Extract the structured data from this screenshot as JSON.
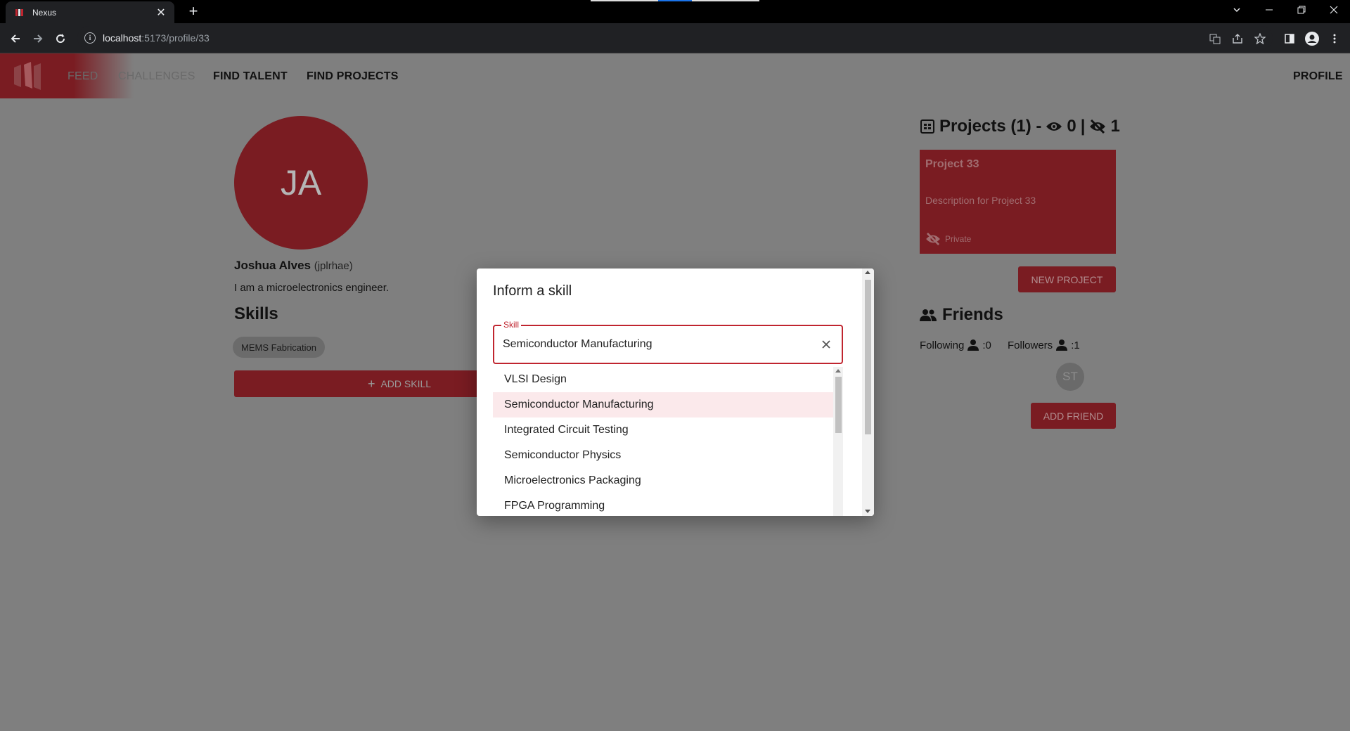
{
  "browser": {
    "tab_title": "Nexus",
    "tab_close": "✕",
    "new_tab": "+",
    "url_host": "localhost",
    "url_rest": ":5173/profile/33",
    "colors": {
      "chrome_dark": "#202124",
      "tabstrip": "#000000"
    }
  },
  "nav": {
    "items": [
      "FEED",
      "CHALLENGES",
      "FIND TALENT",
      "FIND PROJECTS"
    ],
    "profile": "PROFILE"
  },
  "profile": {
    "initials": "JA",
    "name": "Joshua Alves",
    "handle": "(jplrhae)",
    "bio": "I am a microelectronics engineer.",
    "skills_heading": "Skills",
    "skills": [
      "MEMS Fabrication"
    ],
    "add_skill_label": "ADD SKILL"
  },
  "projects": {
    "heading": "Projects (1) -",
    "public_count": "0",
    "separator": "|",
    "private_count": "1",
    "card": {
      "title": "Project 33",
      "description": "Description for Project 33",
      "visibility": "Private"
    },
    "new_project_label": "NEW PROJECT"
  },
  "friends": {
    "heading": "Friends",
    "following_label": "Following",
    "following_count": ":0",
    "followers_label": "Followers",
    "followers_count": ":1",
    "friend_initials": "ST",
    "add_friend_label": "ADD FRIEND"
  },
  "dialog": {
    "title": "Inform a skill",
    "field_label": "Skill",
    "field_value": "Semiconductor Manufacturing",
    "options": [
      "VLSI Design",
      "Semiconductor Manufacturing",
      "Integrated Circuit Testing",
      "Semiconductor Physics",
      "Microelectronics Packaging",
      "FPGA Programming"
    ],
    "highlighted_option": "Semiconductor Manufacturing"
  },
  "theme": {
    "brand": "#7a1c22",
    "accent": "#c0252f",
    "overlay": "#7f7f7f",
    "option_highlight": "#fbe9eb"
  }
}
